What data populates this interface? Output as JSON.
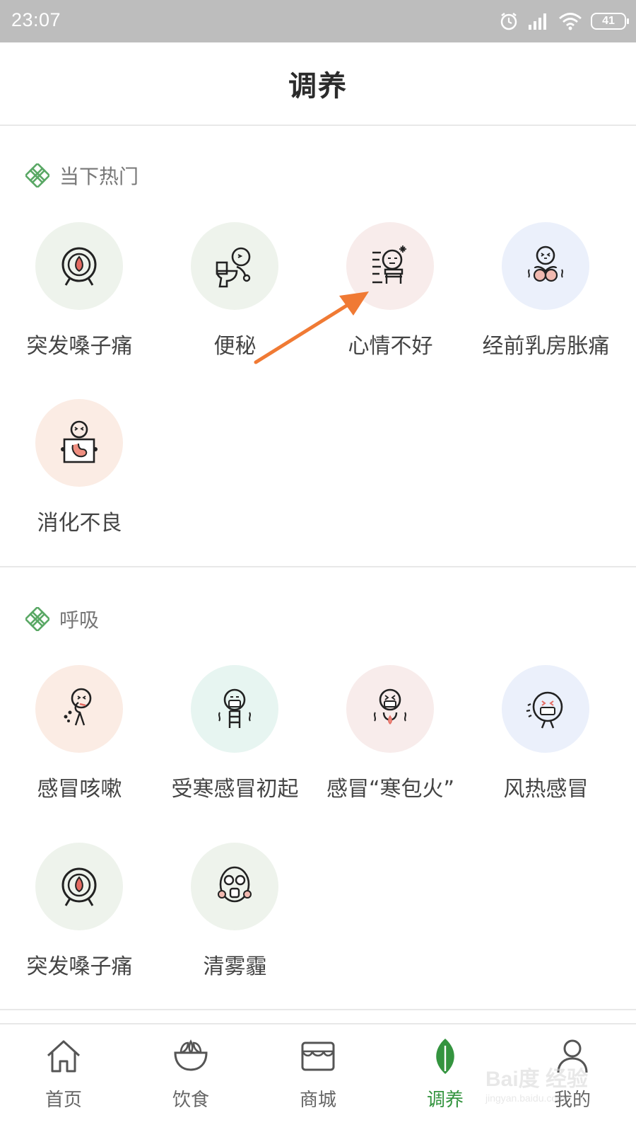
{
  "status_bar": {
    "time": "23:07",
    "battery": "41"
  },
  "header": {
    "title": "调养"
  },
  "sections": [
    {
      "title": "当下热门",
      "items": [
        {
          "label": "突发嗓子痛",
          "icon": "throat-icon"
        },
        {
          "label": "便秘",
          "icon": "toilet-icon"
        },
        {
          "label": "心情不好",
          "icon": "bad-mood-icon"
        },
        {
          "label": "经前乳房胀痛",
          "icon": "breast-pain-icon"
        },
        {
          "label": "消化不良",
          "icon": "stomach-icon"
        }
      ]
    },
    {
      "title": "呼吸",
      "items": [
        {
          "label": "感冒咳嗽",
          "icon": "cough-icon"
        },
        {
          "label": "受寒感冒初起",
          "icon": "cold-mask-icon"
        },
        {
          "label": "感冒“寒包火”",
          "icon": "fire-cold-icon"
        },
        {
          "label": "风热感冒",
          "icon": "wind-heat-icon"
        },
        {
          "label": "突发嗓子痛",
          "icon": "throat-icon"
        },
        {
          "label": "清雾霾",
          "icon": "gas-mask-icon"
        }
      ]
    }
  ],
  "bottom_nav": [
    {
      "label": "首页",
      "icon": "home-icon",
      "active": false
    },
    {
      "label": "饮食",
      "icon": "bowl-icon",
      "active": false
    },
    {
      "label": "商城",
      "icon": "shop-icon",
      "active": false
    },
    {
      "label": "调养",
      "icon": "leaf-icon",
      "active": true
    },
    {
      "label": "我的",
      "icon": "user-icon",
      "active": false
    }
  ],
  "watermark": {
    "text": "Bai度 经验",
    "sub": "jingyan.baidu.com"
  },
  "colors": {
    "accent": "#34943f",
    "arrow": "#f07a34",
    "status_bar": "#bdbdbd"
  }
}
